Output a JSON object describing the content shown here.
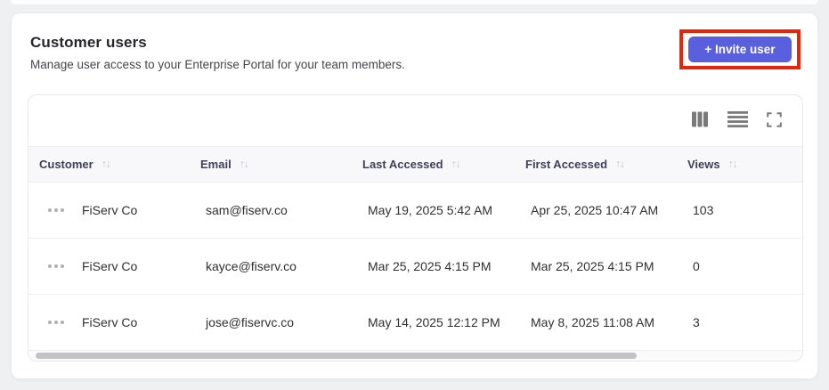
{
  "page": {
    "title": "Customer users",
    "subtitle": "Manage user access to your Enterprise Portal for your team members.",
    "invite_button_label": "+ Invite user"
  },
  "toolbar": {
    "icons": [
      "columns-icon",
      "row-density-icon",
      "fullscreen-icon"
    ],
    "icon_color": "#7a7a7a"
  },
  "table": {
    "sort_icon": "↑↓",
    "columns": [
      {
        "label": "Customer"
      },
      {
        "label": "Email"
      },
      {
        "label": "Last Accessed"
      },
      {
        "label": "First Accessed"
      },
      {
        "label": "Views"
      }
    ],
    "rows": [
      {
        "customer": "FiServ Co",
        "email": "sam@fiserv.co",
        "last_accessed": "May 19, 2025 5:42 AM",
        "first_accessed": "Apr 25, 2025 10:47 AM",
        "views": "103"
      },
      {
        "customer": "FiServ Co",
        "email": "kayce@fiserv.co",
        "last_accessed": "Mar 25, 2025 4:15 PM",
        "first_accessed": "Mar 25, 2025 4:15 PM",
        "views": "0"
      },
      {
        "customer": "FiServ Co",
        "email": "jose@fiservc.co",
        "last_accessed": "May 14, 2025 12:12 PM",
        "first_accessed": "May 8, 2025 11:08 AM",
        "views": "3"
      }
    ]
  },
  "colors": {
    "accent": "#595fdd",
    "annotation_highlight": "#eb2309",
    "page_background": "#eef0f1",
    "header_row_background": "#f8f8fb"
  }
}
